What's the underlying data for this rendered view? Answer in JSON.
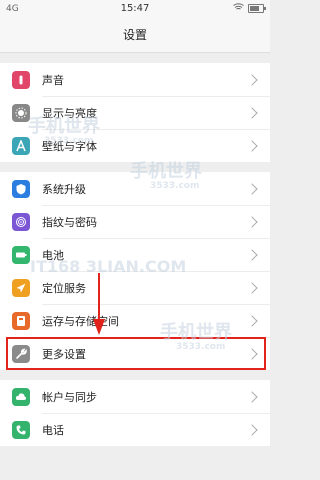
{
  "status": {
    "network": "4G",
    "time": "15:47"
  },
  "title": "设置",
  "groups": [
    [
      {
        "name": "sound",
        "label": "声音",
        "color": "#e2456a",
        "icon": "speaker-icon"
      },
      {
        "name": "display",
        "label": "显示与亮度",
        "color": "#888888",
        "icon": "sun-icon"
      },
      {
        "name": "wallpaper",
        "label": "壁纸与字体",
        "color": "#3aa6b6",
        "icon": "font-icon"
      }
    ],
    [
      {
        "name": "update",
        "label": "系统升级",
        "color": "#2b7de0",
        "icon": "shield-icon"
      },
      {
        "name": "fingerprint",
        "label": "指纹与密码",
        "color": "#7b57d6",
        "icon": "fingerprint-icon"
      },
      {
        "name": "battery",
        "label": "电池",
        "color": "#33b66d",
        "icon": "battery-icon"
      },
      {
        "name": "location",
        "label": "定位服务",
        "color": "#f0a020",
        "icon": "location-icon"
      },
      {
        "name": "storage",
        "label": "运存与存储空间",
        "color": "#e86a2b",
        "icon": "storage-icon"
      },
      {
        "name": "more",
        "label": "更多设置",
        "color": "#8a8a8a",
        "icon": "wrench-icon"
      }
    ],
    [
      {
        "name": "accounts",
        "label": "帐户与同步",
        "color": "#34b36d",
        "icon": "cloud-icon"
      },
      {
        "name": "phone",
        "label": "电话",
        "color": "#34b36d",
        "icon": "phone-icon"
      }
    ]
  ],
  "watermarks": [
    "手机世界",
    "3533.com",
    "手机世界",
    "3533.com",
    "IT168 3LIAN.COM",
    "手机世界",
    "3533.com"
  ]
}
